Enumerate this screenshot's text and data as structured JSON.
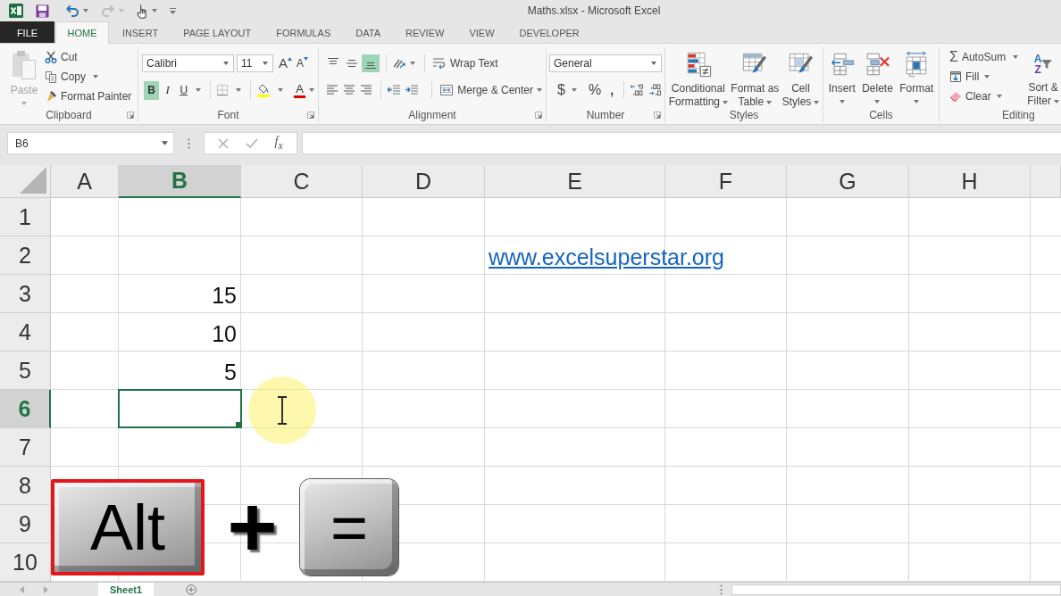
{
  "window": {
    "title": "Maths.xlsx - Microsoft Excel"
  },
  "tabs": [
    {
      "label": "FILE",
      "kind": "backstage",
      "selected": false
    },
    {
      "label": "HOME",
      "kind": "tab",
      "selected": true
    },
    {
      "label": "INSERT",
      "kind": "tab",
      "selected": false
    },
    {
      "label": "PAGE LAYOUT",
      "kind": "tab",
      "selected": false
    },
    {
      "label": "FORMULAS",
      "kind": "tab",
      "selected": false
    },
    {
      "label": "DATA",
      "kind": "tab",
      "selected": false
    },
    {
      "label": "REVIEW",
      "kind": "tab",
      "selected": false
    },
    {
      "label": "VIEW",
      "kind": "tab",
      "selected": false
    },
    {
      "label": "DEVELOPER",
      "kind": "tab",
      "selected": false
    }
  ],
  "ribbon": {
    "clipboard": {
      "label": "Clipboard",
      "paste": {
        "label": "Paste",
        "disabled": true
      },
      "cut": "Cut",
      "copy": "Copy",
      "format_painter": "Format Painter"
    },
    "font": {
      "label": "Font",
      "font_name": "Calibri",
      "font_size": "11",
      "grow_font": "A",
      "shrink_font": "A",
      "styles": [
        {
          "label": "B",
          "kind": "bold",
          "selected": true
        },
        {
          "label": "I",
          "kind": "italic",
          "selected": false
        },
        {
          "label": "U",
          "kind": "underline",
          "selected": false
        }
      ],
      "font_color": "A"
    },
    "alignment": {
      "label": "Alignment",
      "vertical": [
        {
          "kind": "top",
          "selected": false
        },
        {
          "kind": "middle",
          "selected": false
        },
        {
          "kind": "bottom",
          "selected": true
        }
      ],
      "horizontal": [
        {
          "kind": "left",
          "selected": false
        },
        {
          "kind": "center",
          "selected": false
        },
        {
          "kind": "right",
          "selected": false
        }
      ],
      "wrap_text": "Wrap Text",
      "merge": "Merge & Center"
    },
    "number": {
      "label": "Number",
      "format": "General",
      "currency": "$",
      "percent": "%",
      "comma": ","
    },
    "styles": {
      "label": "Styles",
      "buttons": [
        {
          "kind": "conditional",
          "lines": [
            "Conditional",
            "Formatting"
          ]
        },
        {
          "kind": "table",
          "lines": [
            "Format as",
            "Table"
          ]
        },
        {
          "kind": "cell",
          "lines": [
            "Cell",
            "Styles"
          ]
        }
      ]
    },
    "cells": {
      "label": "Cells",
      "buttons": [
        {
          "kind": "insert",
          "label": "Insert"
        },
        {
          "kind": "delete",
          "label": "Delete"
        },
        {
          "kind": "format",
          "label": "Format"
        }
      ]
    },
    "editing": {
      "label": "Editing",
      "autosum_symbol": "Σ",
      "autosum": "AutoSum",
      "fill": "Fill",
      "clear": "Clear",
      "sort_glyphs": [
        "A",
        "Z"
      ],
      "sort_filter": [
        "Sort &",
        "Filter"
      ]
    }
  },
  "formula_bar": {
    "name_box": "B6",
    "function": "f$_{x}$"
  },
  "sheet": {
    "columns": [
      {
        "label": "A",
        "selected": false
      },
      {
        "label": "B",
        "selected": true
      },
      {
        "label": "C",
        "selected": false
      },
      {
        "label": "D",
        "selected": false
      },
      {
        "label": "E",
        "selected": false
      },
      {
        "label": "F",
        "selected": false
      },
      {
        "label": "G",
        "selected": false
      },
      {
        "label": "H",
        "selected": false
      }
    ],
    "rows": [
      {
        "label": "1",
        "selected": false
      },
      {
        "label": "2",
        "selected": false,
        "cells": [
          null,
          null,
          null,
          null,
          {
            "kind": "link",
            "value": "www.excelsuperstar.org",
            "selected": false
          }
        ]
      },
      {
        "label": "3",
        "selected": false,
        "cells": [
          null,
          {
            "kind": "number",
            "value": "15",
            "selected": false
          }
        ]
      },
      {
        "label": "4",
        "selected": false,
        "cells": [
          null,
          {
            "kind": "number",
            "value": "10",
            "selected": false
          }
        ]
      },
      {
        "label": "5",
        "selected": false,
        "cells": [
          null,
          {
            "kind": "number",
            "value": "5",
            "selected": false
          }
        ]
      },
      {
        "label": "6",
        "selected": true,
        "cells": [
          null,
          {
            "selected": true
          }
        ]
      },
      {
        "label": "7",
        "selected": false
      },
      {
        "label": "8",
        "selected": false
      },
      {
        "label": "9",
        "selected": false
      },
      {
        "label": "10",
        "selected": false
      }
    ]
  },
  "sheet_tabs": [
    {
      "label": "Sheet1",
      "selected": true
    }
  ],
  "shortcut": {
    "keys": [
      {
        "label": "Alt",
        "highlighted": true
      },
      {
        "label": "=",
        "highlighted": false
      }
    ],
    "joiner": "+"
  }
}
